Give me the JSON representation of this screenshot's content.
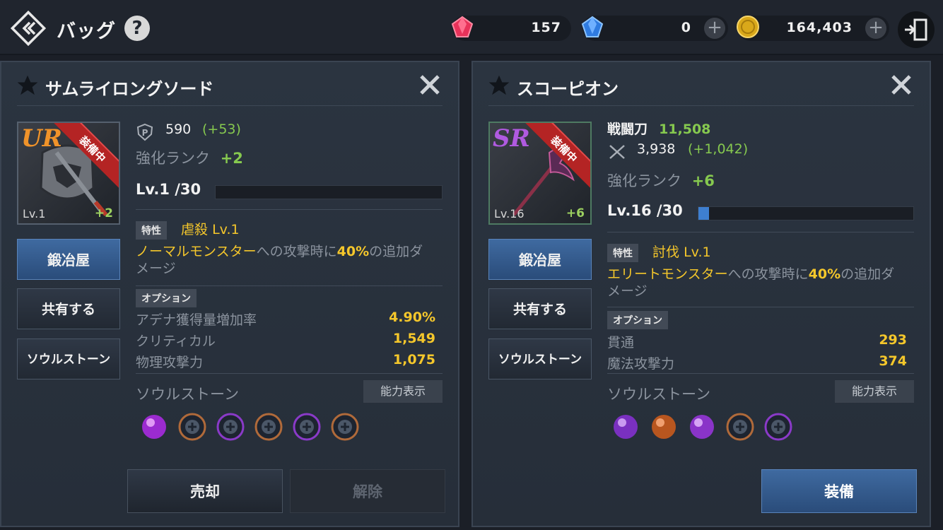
{
  "header": {
    "title": "バッグ",
    "help": "?",
    "currencies": [
      {
        "name": "red-gem",
        "value": "157",
        "color": "#e8325a"
      },
      {
        "name": "blue-gem",
        "value": "0",
        "color": "#3a8ee8"
      },
      {
        "name": "gold-coin",
        "value": "164,403",
        "color": "#e0b21e"
      }
    ],
    "plus": "+"
  },
  "left": {
    "title": "サムライロングソード",
    "rank": "UR",
    "rank_color": "#f0932a",
    "equip_badge": "装備中",
    "thumb_lv": "Lv.1",
    "thumb_plus": "+2",
    "power": "590",
    "power_bonus": "(+53)",
    "enh_label": "強化ランク",
    "enh_value": "+2",
    "level": "Lv.1 /30",
    "level_fraction": 0.0,
    "trait_tag": "特性",
    "trait_name": "虐殺 Lv.1",
    "desc_target": "ノーマルモンスター",
    "desc_mid": "への攻撃時に",
    "desc_pct": "40%",
    "desc_end": "の追加ダ",
    "desc_line2": "メージ",
    "option_tag": "オプション",
    "options": [
      {
        "k": "アデナ獲得量増加率",
        "v": "4.90%"
      },
      {
        "k": "クリティカル",
        "v": "1,549"
      },
      {
        "k": "物理攻撃力",
        "v": "1,075"
      }
    ],
    "soulstone_label": "ソウルストーン",
    "ability_btn": "能力表示",
    "buttons": {
      "smith": "鍛冶屋",
      "share": "共有する",
      "soul": "ソウルストーン"
    },
    "sell": "売却",
    "unequip": "解除"
  },
  "right": {
    "title": "スコーピオン",
    "rank": "SR",
    "rank_color": "#b05ae0",
    "equip_badge": "装備中",
    "thumb_lv": "Lv.16",
    "thumb_plus": "+6",
    "combat_label": "戦闘刀",
    "combat_value": "11,508",
    "attack": "3,938",
    "attack_bonus": "(+1,042)",
    "enh_label": "強化ランク",
    "enh_value": "+6",
    "level": "Lv.16 /30",
    "level_fraction": 0.05,
    "trait_tag": "特性",
    "trait_name": "討伐 Lv.1",
    "desc_target": "エリートモンスター",
    "desc_mid": "への攻撃時に",
    "desc_pct": "40%",
    "desc_end": "の追加ダ",
    "desc_line2": "メージ",
    "option_tag": "オプション",
    "options": [
      {
        "k": "貫通",
        "v": "293"
      },
      {
        "k": "魔法攻撃力",
        "v": "374"
      }
    ],
    "soulstone_label": "ソウルストーン",
    "ability_btn": "能力表示",
    "buttons": {
      "smith": "鍛冶屋",
      "share": "共有する",
      "soul": "ソウルストーン"
    },
    "equip": "装備"
  }
}
